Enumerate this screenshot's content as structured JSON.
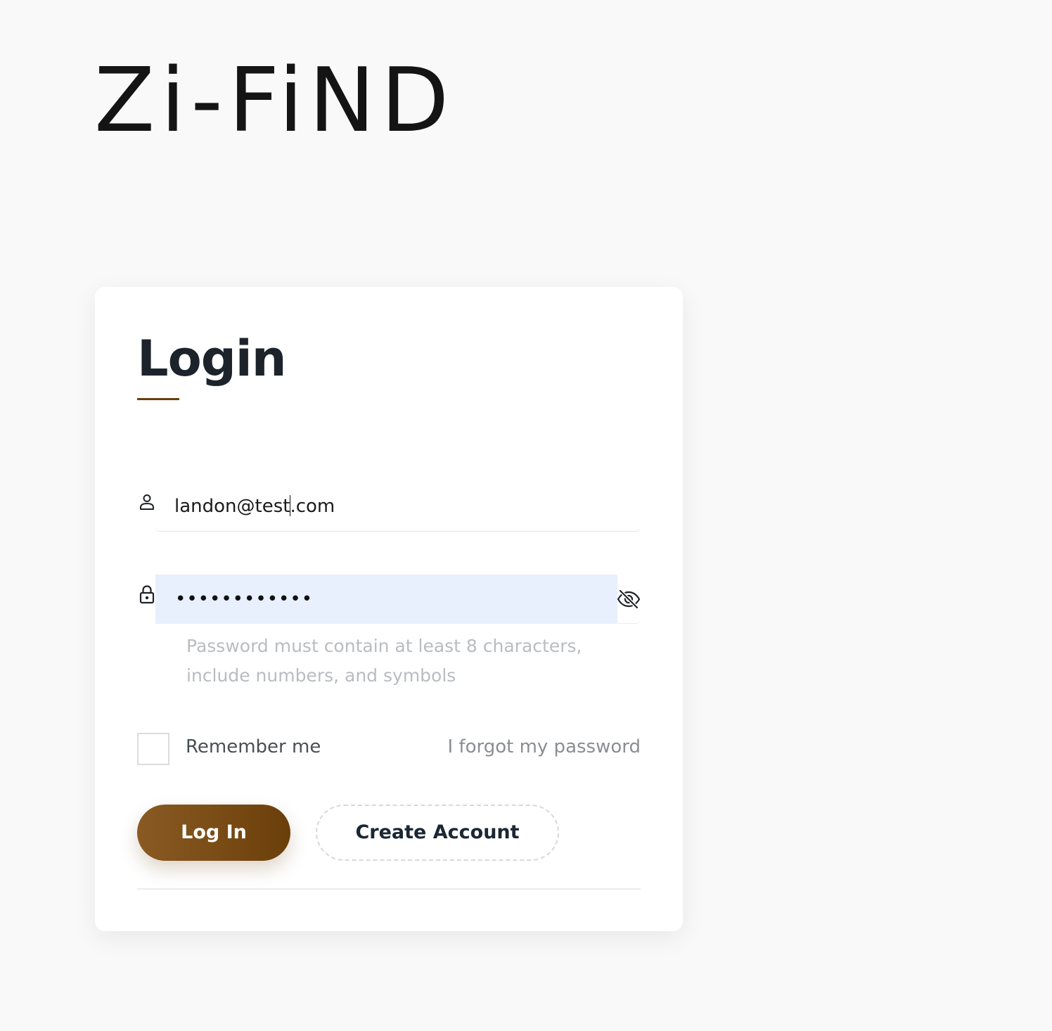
{
  "logo": {
    "text": "Zi-FiND"
  },
  "login_form": {
    "title": "Login",
    "email": {
      "value_before_caret": "landon@test",
      "value_after_caret": ".com",
      "icon": "user-icon"
    },
    "password": {
      "masked_value": "••••••••••••",
      "icon": "lock-icon",
      "toggle_icon": "eye-off-icon",
      "hint": "Password must contain at least 8 characters, include numbers, and symbols"
    },
    "remember_me": {
      "label": "Remember me",
      "checked": false
    },
    "forgot_password_label": "I forgot my password",
    "login_button_label": "Log In",
    "create_account_button_label": "Create Account"
  },
  "colors": {
    "accent": "#6b3f0a",
    "accent_light": "#8a5a23",
    "autofill_background": "#e8f0fe",
    "page_background": "#f9f9f9"
  }
}
